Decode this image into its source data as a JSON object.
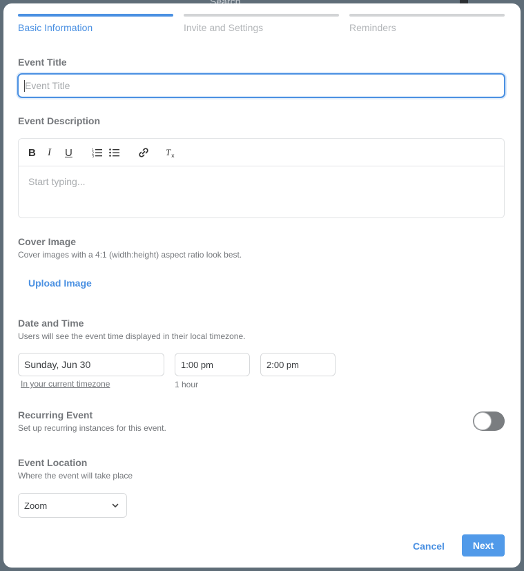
{
  "background": {
    "search_text": "Search"
  },
  "stepper": {
    "steps": [
      {
        "label": "Basic Information",
        "active": true
      },
      {
        "label": "Invite and Settings",
        "active": false
      },
      {
        "label": "Reminders",
        "active": false
      }
    ]
  },
  "event_title": {
    "label": "Event Title",
    "placeholder": "Event Title",
    "value": ""
  },
  "event_description": {
    "label": "Event Description",
    "placeholder": "Start typing...",
    "toolbar": [
      "bold-icon",
      "italic-icon",
      "underline-icon",
      "ordered-list-icon",
      "bullet-list-icon",
      "link-icon",
      "clear-format-icon"
    ]
  },
  "cover_image": {
    "label": "Cover Image",
    "help": "Cover images with a 4:1 (width:height) aspect ratio look best.",
    "upload_label": "Upload Image"
  },
  "date_time": {
    "label": "Date and Time",
    "help": "Users will see the event time displayed in their local timezone.",
    "date": "Sunday, Jun 30",
    "start_time": "1:00 pm",
    "end_time": "2:00 pm",
    "timezone_link": "In your current timezone",
    "duration": "1 hour"
  },
  "recurring": {
    "label": "Recurring Event",
    "help": "Set up recurring instances for this event.",
    "enabled": false
  },
  "location": {
    "label": "Event Location",
    "help": "Where the event will take place",
    "selected": "Zoom"
  },
  "actions": {
    "cancel_label": "Cancel",
    "next_label": "Next"
  },
  "colors": {
    "accent": "#4a90e2",
    "primary_button": "#519ae9",
    "toggle_off": "#7a7d80"
  }
}
